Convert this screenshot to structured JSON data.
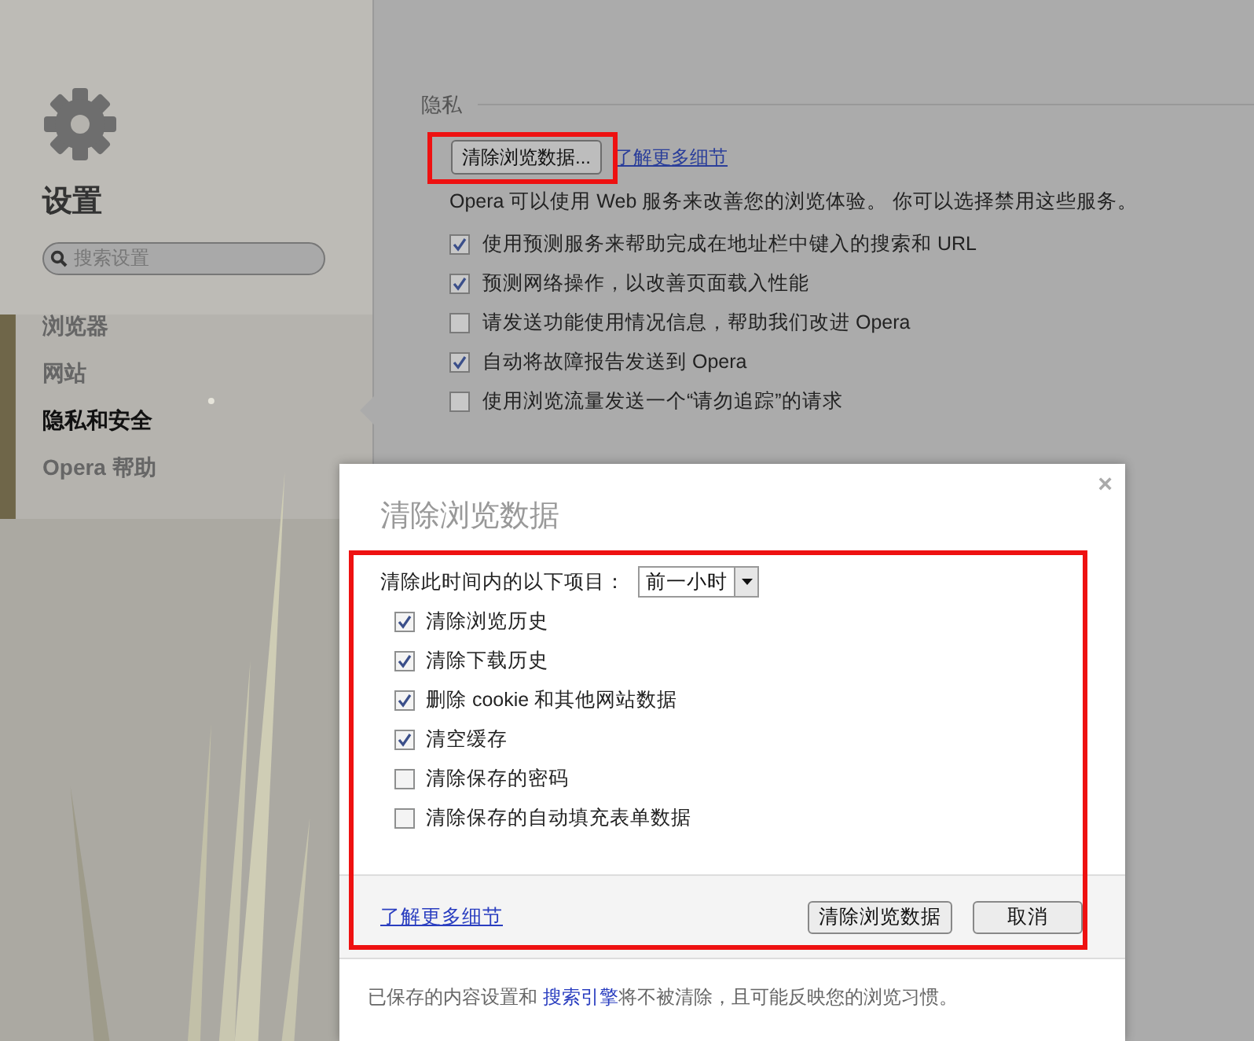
{
  "sidebar": {
    "title": "设置",
    "search": {
      "placeholder": "搜索设置"
    },
    "items": [
      {
        "label": "浏览器",
        "selected": false
      },
      {
        "label": "网站",
        "selected": false
      },
      {
        "label": "隐私和安全",
        "selected": true
      },
      {
        "label": "Opera 帮助",
        "selected": false
      }
    ]
  },
  "privacy": {
    "heading": "隐私",
    "clear_button": "清除浏览数据...",
    "learn_more": "了解更多细节",
    "intro": "Opera 可以使用 Web 服务来改善您的浏览体验。 你可以选择禁用这些服务。",
    "options": [
      {
        "label": "使用预测服务来帮助完成在地址栏中键入的搜索和 URL",
        "checked": true
      },
      {
        "label": "预测网络操作，以改善页面载入性能",
        "checked": true
      },
      {
        "label": "请发送功能使用情况信息，帮助我们改进 Opera",
        "checked": false
      },
      {
        "label": "自动将故障报告发送到 Opera",
        "checked": true
      },
      {
        "label": "使用浏览流量发送一个“请勿追踪”的请求",
        "checked": false
      }
    ]
  },
  "dialog": {
    "title": "清除浏览数据",
    "close": "×",
    "period_label": "清除此时间内的以下项目：",
    "period_value": "前一小时",
    "items": [
      {
        "label": "清除浏览历史",
        "checked": true
      },
      {
        "label": "清除下载历史",
        "checked": true
      },
      {
        "label": "删除 cookie 和其他网站数据",
        "checked": true
      },
      {
        "label": "清空缓存",
        "checked": true
      },
      {
        "label": "清除保存的密码",
        "checked": false
      },
      {
        "label": "清除保存的自动填充表单数据",
        "checked": false
      }
    ],
    "learn_more": "了解更多细节",
    "buttons": [
      "清除浏览数据",
      "取消"
    ],
    "note_before": "已保存的内容设置和 ",
    "note_link": "搜索引擎",
    "note_after": "将不被清除，且可能反映您的浏览习惯。"
  }
}
